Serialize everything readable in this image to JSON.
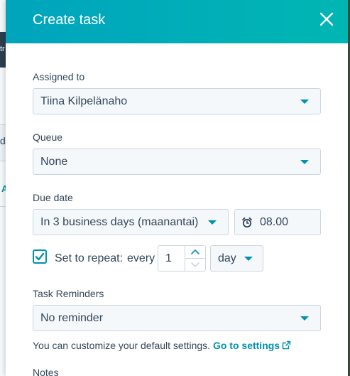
{
  "background": {
    "dark_fragment": "tr",
    "box_fragment": "d",
    "link_fragment": "A"
  },
  "dialog": {
    "title": "Create task"
  },
  "assigned_to": {
    "label": "Assigned to",
    "value": "Tiina Kilpelänaho"
  },
  "queue": {
    "label": "Queue",
    "value": "None"
  },
  "due_date": {
    "label": "Due date",
    "date_value": "In 3 business days (maanantai)",
    "time_value": "08.00"
  },
  "repeat": {
    "checked": true,
    "label": "Set to repeat:",
    "every_label": "every",
    "interval_value": "1",
    "unit_value": "day"
  },
  "reminders": {
    "label": "Task Reminders",
    "value": "No reminder",
    "hint_text": "You can customize your default settings.",
    "hint_link": "Go to settings"
  },
  "notes": {
    "label": "Notes"
  },
  "colors": {
    "header": "#00a4bd",
    "accent": "#0091ae",
    "text": "#33475b",
    "field_bg": "#f5f8fa",
    "border": "#cbd6e2"
  },
  "icons": {
    "close": "close-icon",
    "caret": "chevron-down-icon",
    "clock": "alarm-clock-icon",
    "check": "checkmark-icon",
    "external": "external-link-icon"
  }
}
